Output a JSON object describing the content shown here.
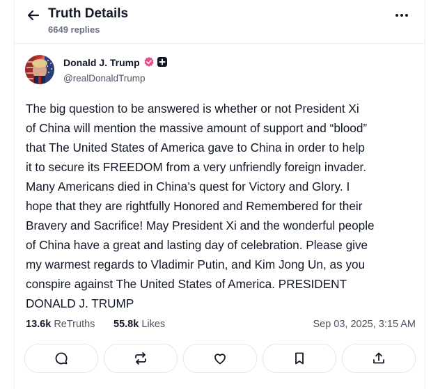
{
  "header": {
    "title": "Truth Details",
    "replies": "6649 replies"
  },
  "post": {
    "author_name": "Donald J. Trump",
    "handle": "@realDonaldTrump",
    "text": "The big question to be  answered is whether or not President Xi\nof China will mention the massive amount of  support and “blood”\nthat The United States of America gave to China in order to help\nit to secure its FREEDOM from a very unfriendly foreign invader.\nMany Americans died in China’s quest for Victory and Glory. I\nhope that they are rightfully Honored and Remembered for their\nBravery and Sacrifice! May President Xi and the wonderful people\nof China have a great and lasting day of celebration. Please give\nmy warmest regards to Vladimir Putin, and Kim Jong Un, as you\nconspire against The United States of America. PRESIDENT\nDONALD J. TRUMP",
    "retruths_count": "13.6k",
    "retruths_label": "ReTruths",
    "likes_count": "55.8k",
    "likes_label": "Likes",
    "timestamp": "Sep 03, 2025, 3:15 AM"
  },
  "icons": {
    "back": "arrow-left-icon",
    "more": "more-horizontal-icon",
    "verified": "verified-badge-icon",
    "plus": "plus-badge-icon",
    "reply": "comment-icon",
    "retruth": "repost-icon",
    "like": "heart-icon",
    "bookmark": "bookmark-icon",
    "share": "share-icon"
  },
  "colors": {
    "verified_badge": "#e94c89",
    "text_primary": "#111827",
    "text_secondary": "#4b5563"
  }
}
